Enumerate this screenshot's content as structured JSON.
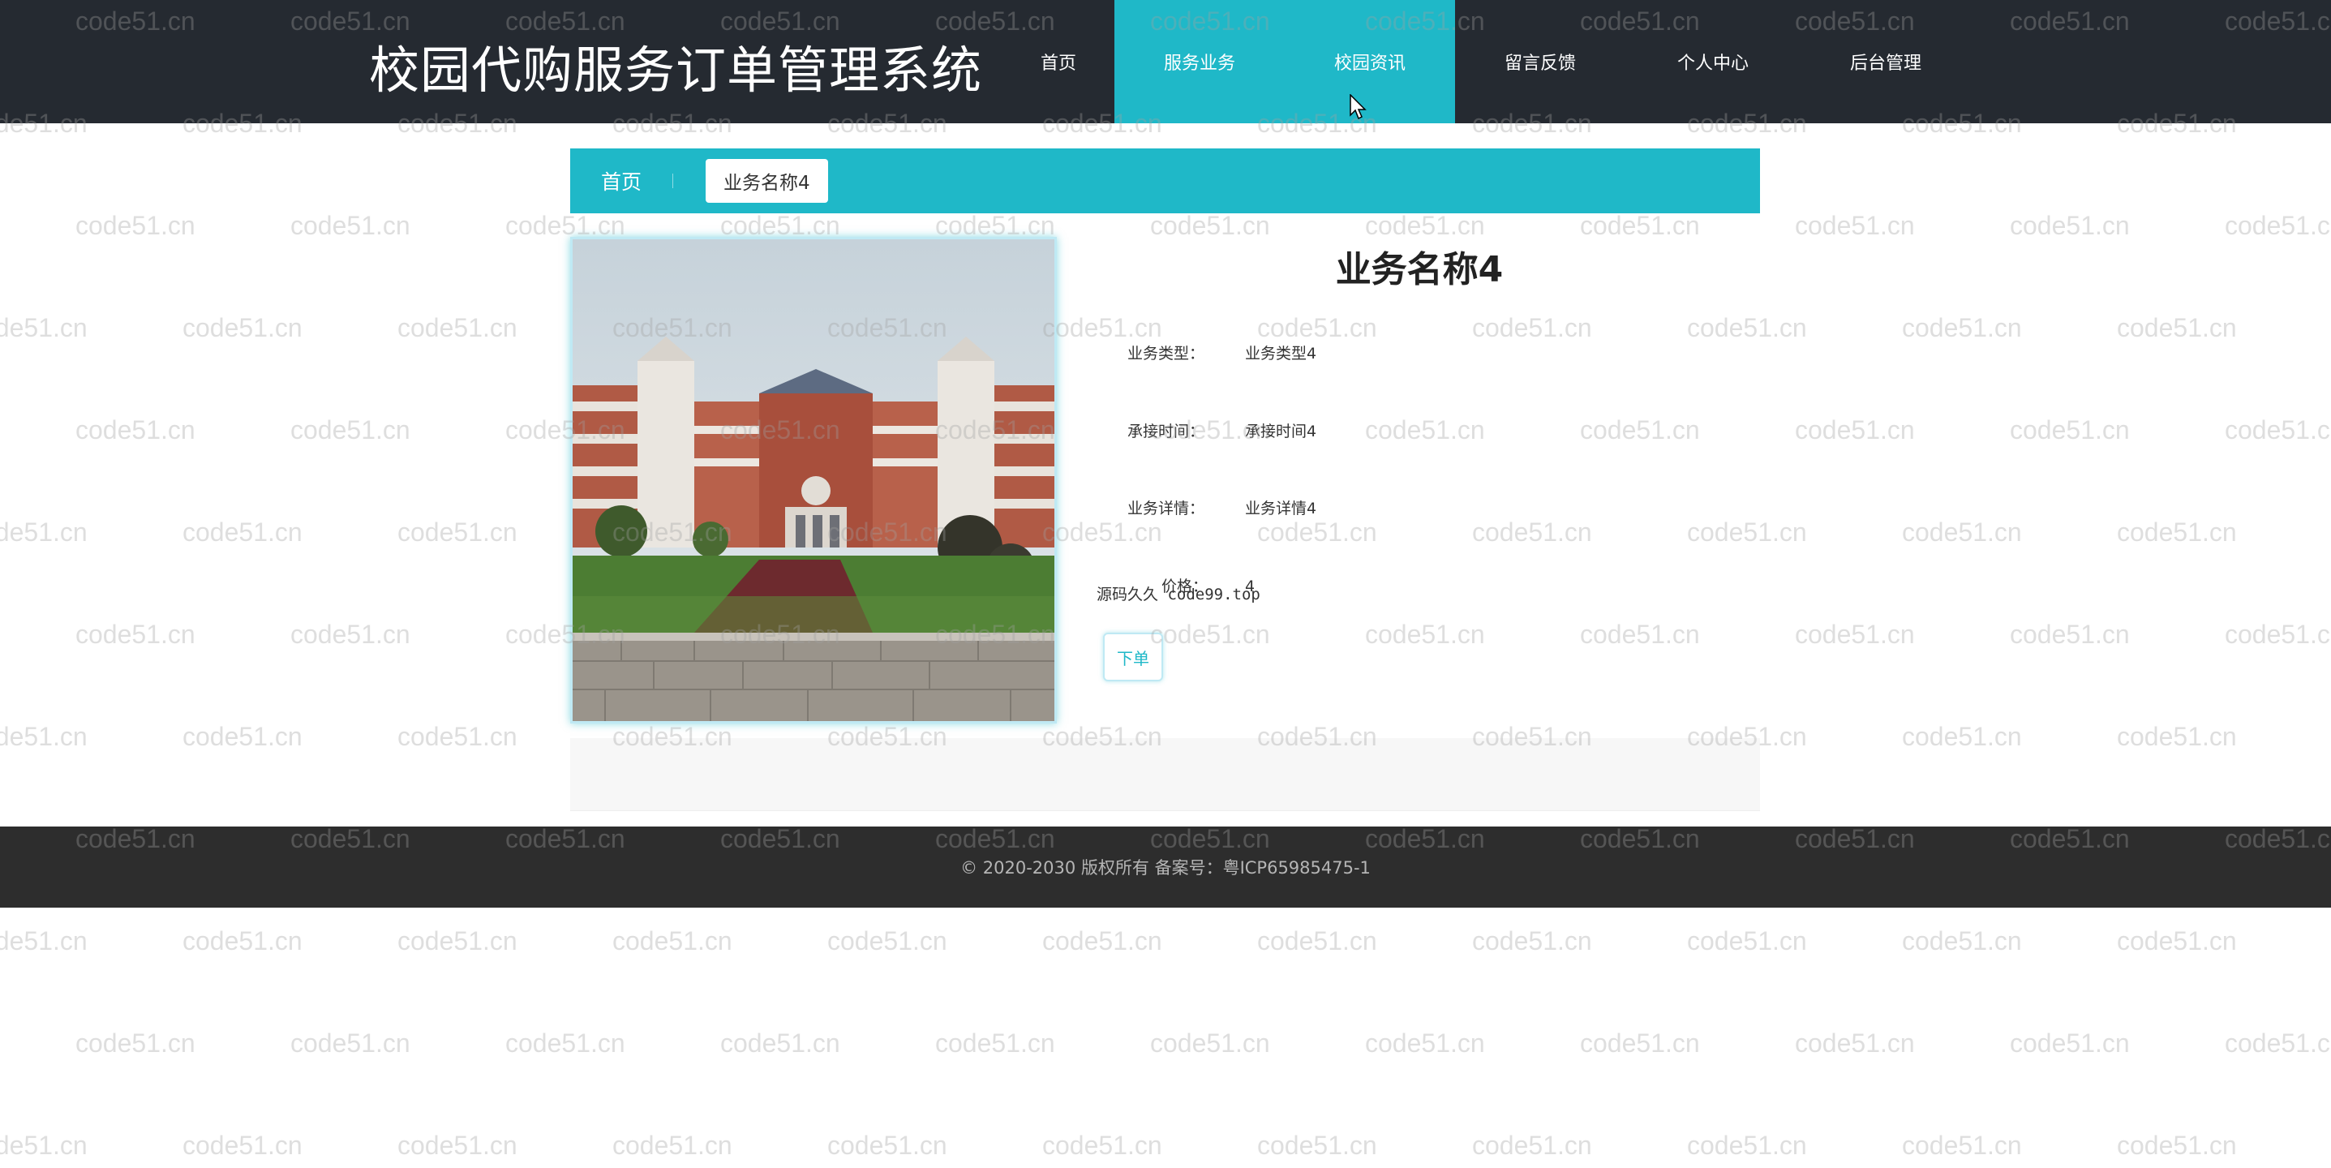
{
  "header": {
    "site_title": "校园代购服务订单管理系统",
    "nav": [
      {
        "label": "首页"
      },
      {
        "label": "服务业务"
      },
      {
        "label": "校园资讯"
      },
      {
        "label": "留言反馈"
      },
      {
        "label": "个人中心"
      },
      {
        "label": "后台管理"
      }
    ]
  },
  "breadcrumb": {
    "home": "首页",
    "current": "业务名称4"
  },
  "product": {
    "title": "业务名称4",
    "fields": [
      {
        "label": "业务类型：",
        "value": "业务类型4"
      },
      {
        "label": "承接时间：",
        "value": "承接时间4"
      },
      {
        "label": "业务详情：",
        "value": "业务详情4"
      },
      {
        "label": "价格：",
        "value": "4"
      }
    ],
    "overlay_text": "源码久久 code99.top",
    "order_button": "下单"
  },
  "footer": {
    "copyright": "© 2020-2030 版权所有 备案号：粤ICP65985475-1"
  },
  "watermark": "code51.cn",
  "colors": {
    "header_bg": "#252a31",
    "accent": "#1fb8c8",
    "footer_bg": "#2d2d2d"
  }
}
